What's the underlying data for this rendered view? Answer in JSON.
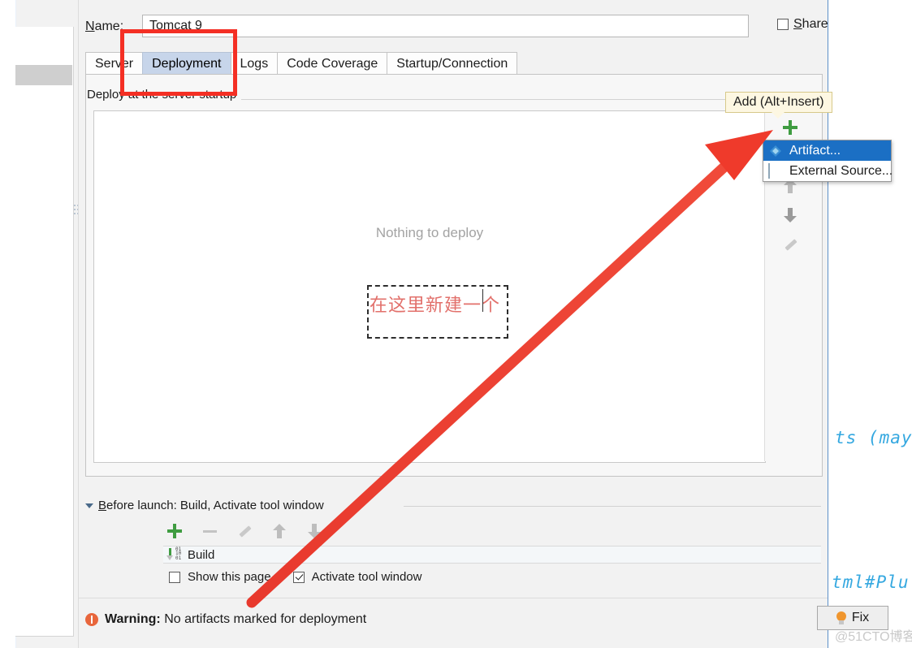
{
  "dialog": {
    "name_field": {
      "label": "Name:",
      "label_accel": "N",
      "value": "Tomcat 9",
      "placeholder": "Name"
    },
    "share": {
      "label": "Share",
      "label_accel": "S",
      "checked": false
    },
    "tabs": [
      {
        "label": "Server",
        "active": false
      },
      {
        "label": "Deployment",
        "active": true
      },
      {
        "label": "Logs",
        "active": false
      },
      {
        "label": "Code Coverage",
        "active": false
      },
      {
        "label": "Startup/Connection",
        "active": false
      }
    ],
    "deployment": {
      "group_label": "Deploy at the server startup",
      "empty_text": "Nothing to deploy",
      "toolbar": [
        {
          "name": "add",
          "icon": "plus-icon",
          "enabled": true
        },
        {
          "name": "remove",
          "icon": "minus-icon",
          "enabled": false
        },
        {
          "name": "up",
          "icon": "arrow-up-icon",
          "enabled": false
        },
        {
          "name": "down",
          "icon": "arrow-down-icon",
          "enabled": false
        },
        {
          "name": "edit",
          "icon": "pencil-icon",
          "enabled": false
        }
      ],
      "tooltip": "Add (Alt+Insert)",
      "menu": [
        {
          "label": "Artifact...",
          "icon": "artifact-icon",
          "selected": true
        },
        {
          "label": "External Source...",
          "icon": "external-source-icon",
          "selected": false
        }
      ]
    },
    "before_launch": {
      "header": "Before launch: Build, Activate tool window",
      "header_accel": "B",
      "toolbar": [
        {
          "name": "add",
          "icon": "plus-icon",
          "enabled": true
        },
        {
          "name": "remove",
          "icon": "minus-icon",
          "enabled": false
        },
        {
          "name": "edit",
          "icon": "pencil-icon",
          "enabled": false
        },
        {
          "name": "up",
          "icon": "arrow-up-icon",
          "enabled": false
        },
        {
          "name": "down",
          "icon": "arrow-down-icon",
          "enabled": false
        }
      ],
      "items": [
        {
          "label": "Build",
          "icon": "build-icon"
        }
      ],
      "show_this_page": {
        "label": "Show this page",
        "checked": false
      },
      "activate_tool_window": {
        "label": "Activate tool window",
        "checked": true
      }
    },
    "warning": {
      "prefix": "Warning:",
      "message": "No artifacts marked for deployment",
      "fix_label": "Fix"
    }
  },
  "annotations": {
    "chinese_note": "在这里新建一个",
    "note_color": "#e2706b",
    "highlight_color": "#f42f24"
  },
  "background": {
    "code_line_1": "ts (may",
    "code_line_2": "tml#Plu",
    "code_color": "#35a8e0",
    "watermark": "@51CTO博客"
  },
  "colors": {
    "accent_tab": "#c7d5ea",
    "menu_selection": "#1b6fc4",
    "warning": "#e8663c",
    "add_green": "#3f9c41"
  }
}
